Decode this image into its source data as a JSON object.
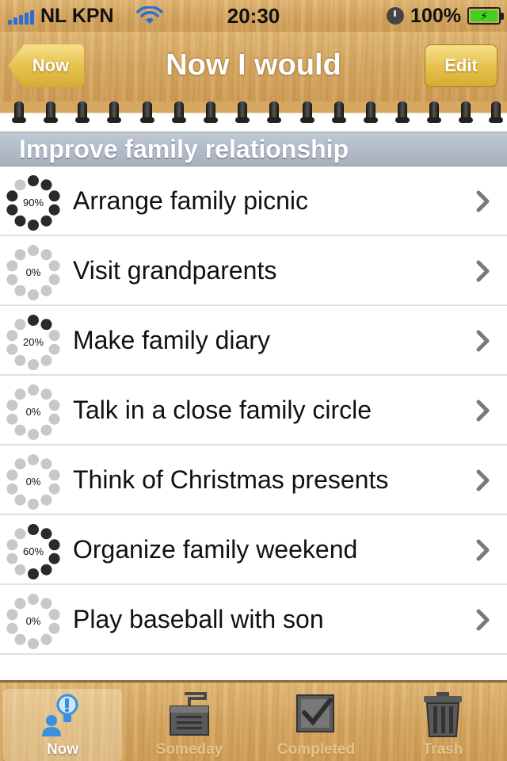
{
  "status_bar": {
    "carrier": "NL KPN",
    "time": "20:30",
    "battery": "100%"
  },
  "nav": {
    "back_label": "Now",
    "title": "Now I would",
    "edit_label": "Edit"
  },
  "section": {
    "title": "Improve family relationship"
  },
  "tasks": [
    {
      "label": "Arrange family picnic",
      "progress": "90%",
      "filled_dots": 9
    },
    {
      "label": "Visit grandparents",
      "progress": "0%",
      "filled_dots": 0
    },
    {
      "label": "Make family diary",
      "progress": "20%",
      "filled_dots": 2
    },
    {
      "label": "Talk in a close family circle",
      "progress": "0%",
      "filled_dots": 0
    },
    {
      "label": "Think of Christmas presents",
      "progress": "0%",
      "filled_dots": 0
    },
    {
      "label": "Organize family weekend",
      "progress": "60%",
      "filled_dots": 6
    },
    {
      "label": "Play baseball with son",
      "progress": "0%",
      "filled_dots": 0
    }
  ],
  "tabs": [
    {
      "label": "Now",
      "icon": "person-lightbulb-icon",
      "active": true
    },
    {
      "label": "Someday",
      "icon": "inbox-tray-icon",
      "active": false
    },
    {
      "label": "Completed",
      "icon": "checkbox-icon",
      "active": false
    },
    {
      "label": "Trash",
      "icon": "trash-can-icon",
      "active": false
    }
  ],
  "colors": {
    "wood": "#d9ae6a",
    "section_header": "#a5b0be",
    "dot_filled": "#2a2a2a",
    "dot_empty": "#c8c8c8",
    "tab_active_icon": "#3a8fe0"
  }
}
